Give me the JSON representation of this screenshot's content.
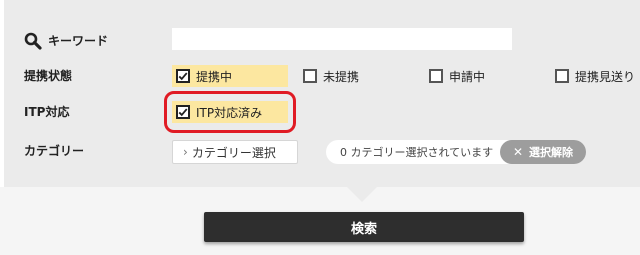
{
  "filters": {
    "keyword": {
      "label": "キーワード",
      "value": "",
      "placeholder": ""
    },
    "status": {
      "label": "提携状態",
      "options": [
        {
          "label": "提携中",
          "checked": true
        },
        {
          "label": "未提携",
          "checked": false
        },
        {
          "label": "申請中",
          "checked": false
        },
        {
          "label": "提携見送り",
          "checked": false
        }
      ]
    },
    "itp": {
      "label": "ITP対応",
      "options": [
        {
          "label": "ITP対応済み",
          "checked": true
        }
      ]
    },
    "category": {
      "label": "カテゴリー",
      "select_label": "カテゴリー選択",
      "selected_text": "0 カテゴリー選択されています",
      "clear_label": "選択解除"
    }
  },
  "actions": {
    "search_label": "検索"
  },
  "colors": {
    "panel_bg": "#ebebeb",
    "checked_bg": "#fce7a0",
    "highlight": "#e01b24",
    "search_button": "#2e2e2e",
    "clear_button": "#9d9d9d"
  },
  "icons": [
    "search-icon",
    "checkmark-icon",
    "chevron-right-icon",
    "close-icon"
  ]
}
